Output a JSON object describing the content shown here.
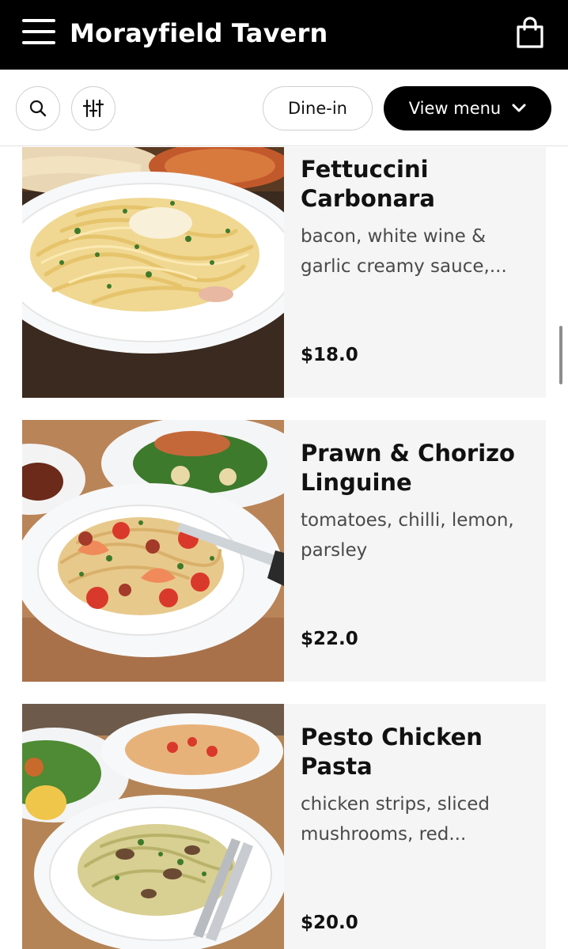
{
  "header": {
    "title": "Morayfield Tavern",
    "menu_icon": "hamburger-menu-icon",
    "cart_icon": "shopping-bag-icon",
    "background": "#000000",
    "foreground": "#ffffff"
  },
  "toolbar": {
    "search_icon": "search-icon",
    "filter_icon": "sliders-filter-icon",
    "dine_in_label": "Dine-in",
    "view_menu_label": "View menu",
    "view_menu_icon": "chevron-down-icon"
  },
  "menu_items": [
    {
      "name": "Fettuccini Carbonara",
      "description": "bacon, white wine & garlic creamy sauce,...",
      "price": "$18.0"
    },
    {
      "name": "Prawn & Chorizo Linguine",
      "description": "tomatoes, chilli, lemon, parsley",
      "price": "$22.0"
    },
    {
      "name": "Pesto Chicken Pasta",
      "description": "chicken strips, sliced mushrooms, red...",
      "price": "$20.0"
    }
  ],
  "colors": {
    "card_background": "#f5f5f5",
    "description_text": "#4a4a4a",
    "pill_border": "#cfcfcf"
  }
}
